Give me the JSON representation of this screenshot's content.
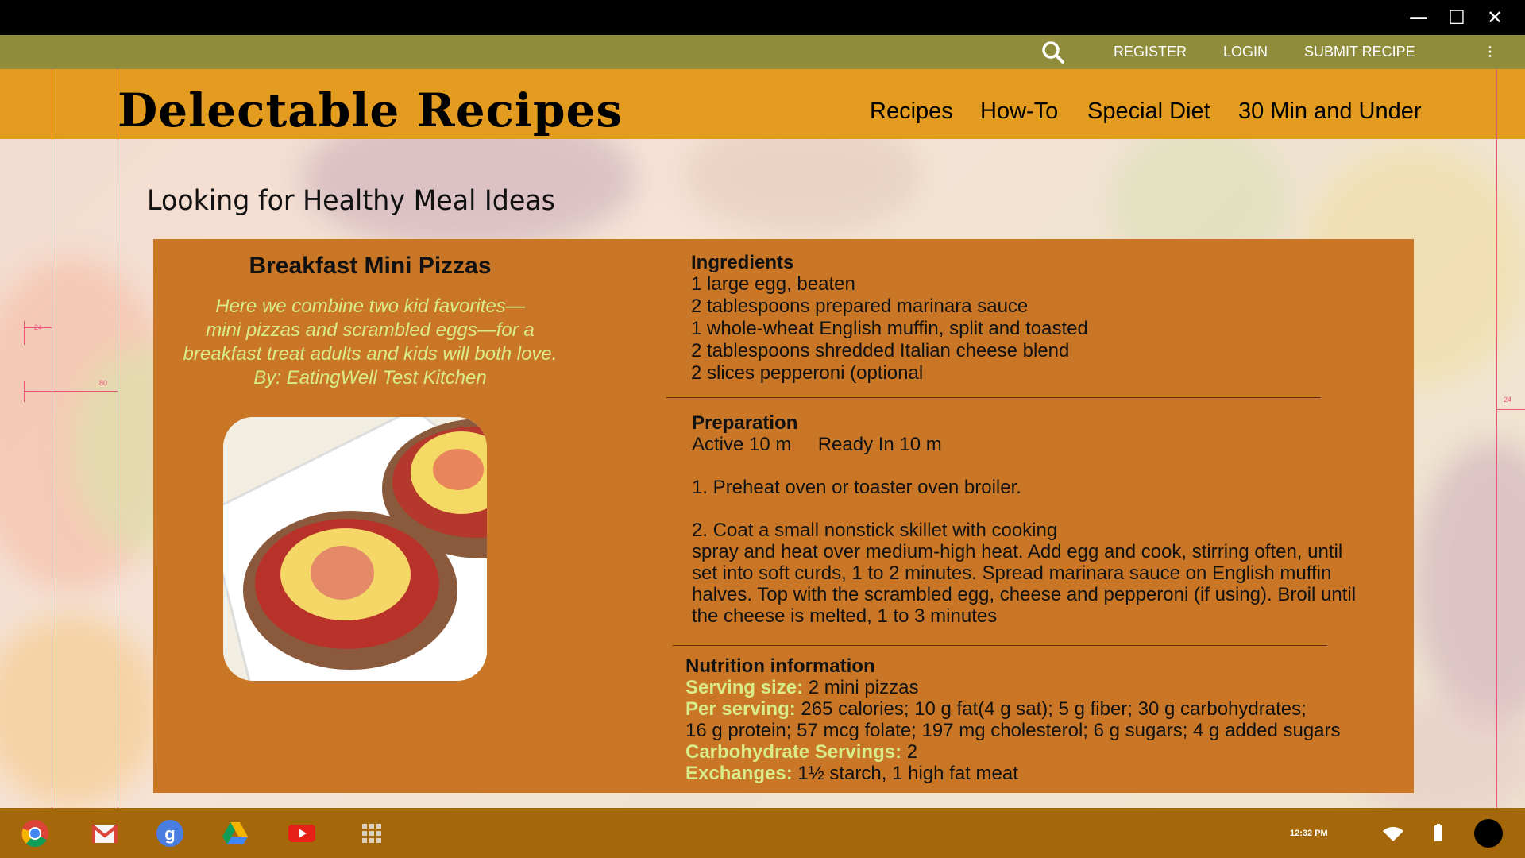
{
  "window_controls": {
    "minimize": "—",
    "maximize": "☐",
    "close": "✕"
  },
  "top_nav": {
    "links": [
      "REGISTER",
      "LOGIN",
      "SUBMIT RECIPE"
    ],
    "more": "⋮"
  },
  "header": {
    "brand": "Delectable Recipes",
    "nav": [
      "Recipes",
      "How-To",
      "Special Diet",
      "30 Min and Under"
    ]
  },
  "guides": {
    "marks": [
      "24",
      "80",
      "24"
    ]
  },
  "page": {
    "headline": "Looking for Healthy Meal Ideas"
  },
  "recipe": {
    "title": "Breakfast Mini Pizzas",
    "description": [
      "Here we combine two kid favorites—",
      "mini pizzas and scrambled eggs—for a",
      "breakfast treat adults and kids will both love.",
      "By: EatingWell Test Kitchen"
    ],
    "ingredients": {
      "heading": "Ingredients",
      "items": [
        "1 large egg, beaten",
        "2 tablespoons prepared marinara sauce",
        "1 whole-wheat English muffin, split and toasted",
        "2 tablespoons shredded Italian cheese blend",
        "2 slices pepperoni (optional"
      ]
    },
    "preparation": {
      "heading": "Preparation",
      "times": "Active 10 m     Ready In 10 m",
      "step1": "1. Preheat oven or toaster oven broiler.",
      "step2_lines": [
        "2. Coat a small nonstick skillet with cooking",
        "spray and heat over medium-high heat. Add egg and cook, stirring often, until",
        "set into soft curds, 1 to 2 minutes. Spread marinara sauce on English muffin",
        "halves. Top with the scrambled egg, cheese and pepperoni (if using). Broil until",
        "the cheese is melted, 1 to 3 minutes"
      ]
    },
    "nutrition": {
      "heading": "Nutrition information",
      "serving_label": "Serving size:",
      "serving_value": " 2 mini pizzas",
      "per_label": "Per serving:",
      "per_value_1": " 265 calories; 10 g fat(4 g sat); 5 g fiber; 30 g carbohydrates;",
      "per_value_2": "16 g protein; 57 mcg folate; 197 mg cholesterol; 6 g sugars; 4 g added sugars",
      "carb_label": "Carbohydrate Servings:",
      "carb_value": " 2",
      "exch_label": "Exchanges:",
      "exch_value": " 1½ starch, 1 high fat meat"
    }
  },
  "taskbar": {
    "apps": [
      "chrome-icon",
      "gmail-icon",
      "google-search-icon",
      "drive-icon",
      "youtube-icon",
      "app-launcher-icon"
    ],
    "clock": "12:32 PM"
  },
  "colors": {
    "top_nav_bg": "#8f8c3b",
    "header_bg": "#e39c1f",
    "card_bg": "#c97726",
    "highlight_text": "#d9ec8a",
    "taskbar_bg": "#a4680a",
    "guide_lines": "#e8557c"
  }
}
